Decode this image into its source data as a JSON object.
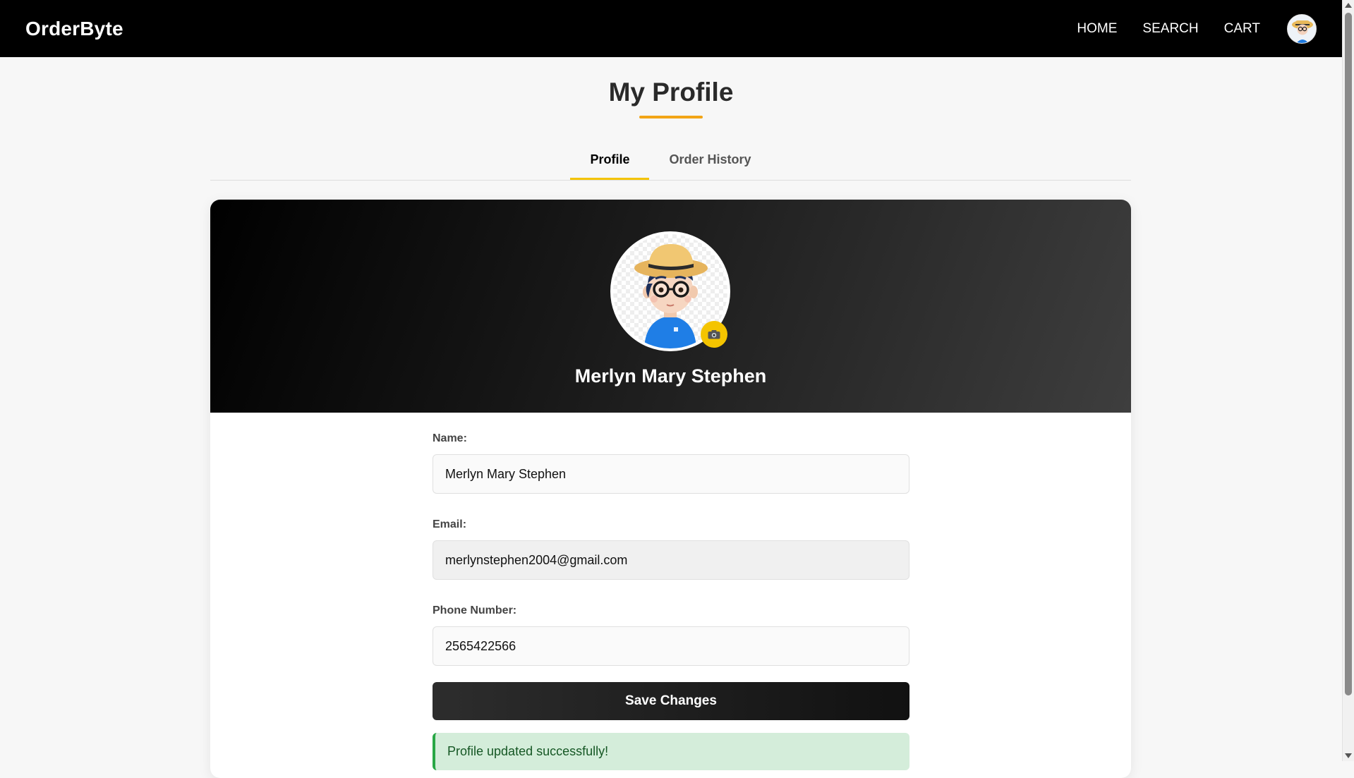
{
  "app": {
    "brand": "OrderByte",
    "nav": [
      {
        "label": "HOME"
      },
      {
        "label": "SEARCH"
      },
      {
        "label": "CART"
      }
    ]
  },
  "page": {
    "title": "My Profile",
    "tabs": [
      {
        "label": "Profile",
        "active": true
      },
      {
        "label": "Order History",
        "active": false
      }
    ]
  },
  "profile": {
    "display_name": "Merlyn Mary Stephen",
    "camera_icon": "camera-icon",
    "avatar_icon": "cartoon-avatar"
  },
  "form": {
    "name_label": "Name:",
    "name_value": "Merlyn Mary Stephen",
    "email_label": "Email:",
    "email_value": "merlynstephen2004@gmail.com",
    "phone_label": "Phone Number:",
    "phone_value": "2565422566",
    "save_label": "Save Changes"
  },
  "alert": {
    "success_text": "Profile updated successfully!"
  },
  "colors": {
    "accent": "#f4c400",
    "title_underline": "#f2a516",
    "navbar": "#000000",
    "success_bg": "#d4edda",
    "success_border": "#28a745"
  }
}
